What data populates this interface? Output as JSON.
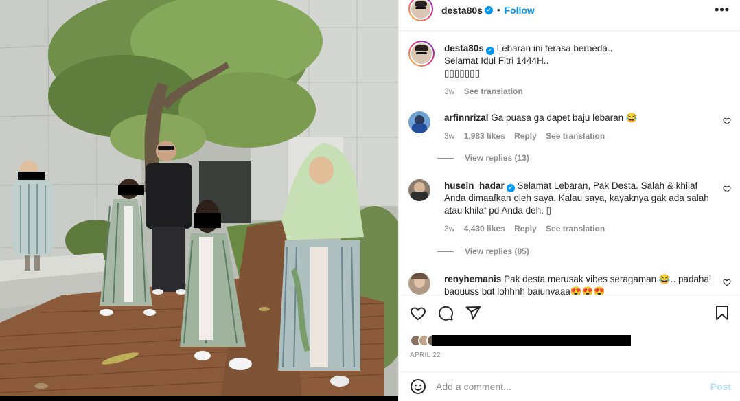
{
  "header": {
    "username": "desta80s",
    "separator": "•",
    "follow_label": "Follow",
    "more_label": "•••"
  },
  "caption": {
    "username": "desta80s",
    "lines": [
      "Lebaran ini terasa berbeda..",
      "Selamat Idul Fitri 1444H..",
      "▯▯▯▯▯▯▯"
    ],
    "time": "3w",
    "see_translation": "See translation"
  },
  "comments": [
    {
      "username": "arfinnrizal",
      "text": "Ga puasa ga dapet baju lebaran 😂",
      "time": "3w",
      "likes": "1,983 likes",
      "reply": "Reply",
      "see_translation": "See translation",
      "view_replies": "View replies (13)"
    },
    {
      "username": "husein_hadar",
      "text": "Selamat Lebaran, Pak Desta. Salah & khilaf Anda dimaafkan oleh saya. Kalau saya, kayaknya gak ada salah atau khilaf pd Anda deh. ▯",
      "time": "3w",
      "likes": "4,430 likes",
      "reply": "Reply",
      "see_translation": "See translation",
      "view_replies": "View replies (85)"
    },
    {
      "username": "renyhemanis",
      "text": "Pak desta merusak vibes seragaman 😂.. padahal baguuss bgt lohhhh bajunyaaa😍😍😍"
    }
  ],
  "icons": {
    "like": "heart-icon",
    "comment": "comment-icon",
    "share": "share-icon",
    "save": "bookmark-icon",
    "emoji": "emoji-icon",
    "verified": "verified-badge-icon"
  },
  "post_date": "APRIL 22",
  "comment_box": {
    "placeholder": "Add a comment...",
    "post_label": "Post"
  },
  "colors": {
    "accent": "#0095f6",
    "muted": "#8e8e8e",
    "post_disabled": "#b2dffc"
  }
}
